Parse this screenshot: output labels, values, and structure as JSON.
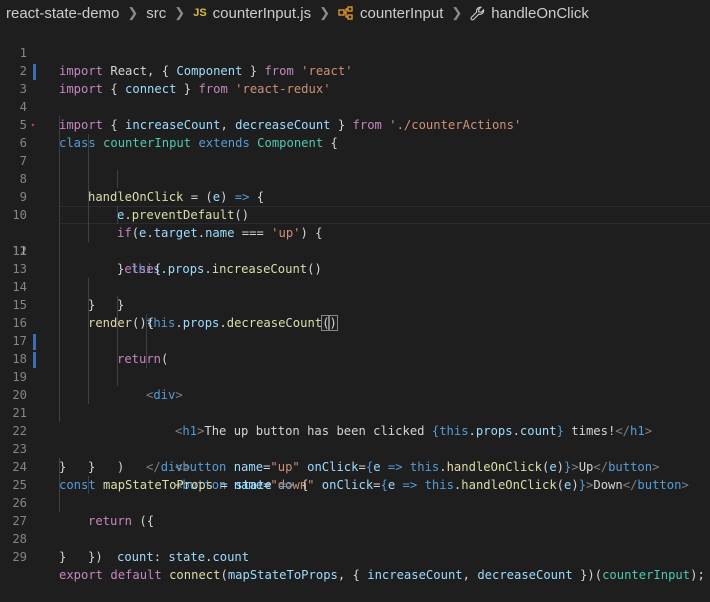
{
  "breadcrumb": {
    "items": [
      "react-state-demo",
      "src",
      "counterInput.js",
      "counterInput",
      "handleOnClick"
    ],
    "file_badge": "JS"
  },
  "line_numbers": [
    "1",
    "2",
    "3",
    "4",
    "5",
    "6",
    "7",
    "8",
    "9",
    "10",
    "11",
    "12",
    "13",
    "14",
    "15",
    "16",
    "17",
    "18",
    "19",
    "20",
    "21",
    "22",
    "23",
    "24",
    "25",
    "26",
    "27",
    "28",
    "29"
  ],
  "code": {
    "l1": [
      "import",
      " React, { ",
      "Component",
      " } ",
      "from",
      " ",
      "'react'"
    ],
    "l2": [
      "import",
      " { ",
      "connect",
      " } ",
      "from",
      " ",
      "'react-redux'"
    ],
    "l3": [
      "import",
      " { ",
      "increaseCount",
      ", ",
      "decreaseCount",
      " } ",
      "from",
      " ",
      "'./counterActions'"
    ],
    "l5": [
      "class",
      " ",
      "counterInput",
      " ",
      "extends",
      " ",
      "Component",
      " {"
    ],
    "l6": [
      "handleOnClick",
      " = (",
      "e",
      ") ",
      "=>",
      " {"
    ],
    "l7": [
      "e",
      ".",
      "preventDefault",
      "()"
    ],
    "l8": [
      "if",
      "(",
      "e",
      ".",
      "target",
      ".",
      "name",
      " === ",
      "'up'",
      ") {"
    ],
    "l9": [
      "this",
      ".",
      "props",
      ".",
      "increaseCount",
      "()"
    ],
    "l10": [
      "}",
      "else",
      "{"
    ],
    "l11": [
      "this",
      ".",
      "props",
      ".",
      "decreaseCount",
      "(",
      ")"
    ],
    "l12": [
      "}"
    ],
    "l13": [
      "}"
    ],
    "l14": [
      "render",
      "(){"
    ],
    "l15": [
      "return",
      "("
    ],
    "l16": [
      "<",
      "div",
      ">"
    ],
    "l17": [
      "<",
      "h1",
      ">",
      "The up button has been clicked ",
      "{",
      "this",
      ".",
      "props",
      ".",
      "count",
      "}",
      " times!",
      "</",
      "h1",
      ">"
    ],
    "l18": [
      "<",
      "button",
      " ",
      "name",
      "=",
      "\"up\"",
      " ",
      "onClick",
      "=",
      "{",
      "e",
      " => ",
      "this",
      ".",
      "handleOnClick",
      "(",
      "e",
      ")",
      "}",
      ">",
      "Up",
      "</",
      "button",
      ">"
    ],
    "l19": [
      "<",
      "button",
      " ",
      "name",
      "=",
      "\"down\"",
      " ",
      "onClick",
      "=",
      "{",
      "e",
      " => ",
      "this",
      ".",
      "handleOnClick",
      "(",
      "e",
      ")",
      "}",
      ">",
      "Down",
      "</",
      "button",
      ">"
    ],
    "l20": [
      "</",
      "div",
      ">"
    ],
    "l21": [
      ")"
    ],
    "l22": [
      "}"
    ],
    "l23": [
      "}"
    ],
    "l24": [
      "const",
      " ",
      "mapStateToProps",
      " = ",
      "state",
      " ",
      "=>",
      " {"
    ],
    "l25": [
      "return",
      " ({"
    ],
    "l26": [
      "count",
      ": ",
      "state",
      ".",
      "count"
    ],
    "l27": [
      "})"
    ],
    "l28": [
      "}"
    ],
    "l29": [
      "export",
      " ",
      "default",
      " ",
      "connect",
      "(",
      "mapStateToProps",
      ", { ",
      "increaseCount",
      ", ",
      "decreaseCount",
      " })(",
      "counterInput",
      ");"
    ]
  },
  "colors": {
    "background": "#1e1e1e",
    "keyword": "#569cd6",
    "control": "#c586c0",
    "string": "#ce9178",
    "function": "#dcdcaa",
    "variable": "#9cdcfe",
    "class": "#4ec9b0",
    "line_number": "#858585",
    "modified_bar": "#3d6fb0"
  },
  "icons": {
    "breadcrumb_separator": "chevron-right-icon",
    "symbol_class": "symbol-class-icon",
    "symbol_method": "wrench-icon"
  }
}
